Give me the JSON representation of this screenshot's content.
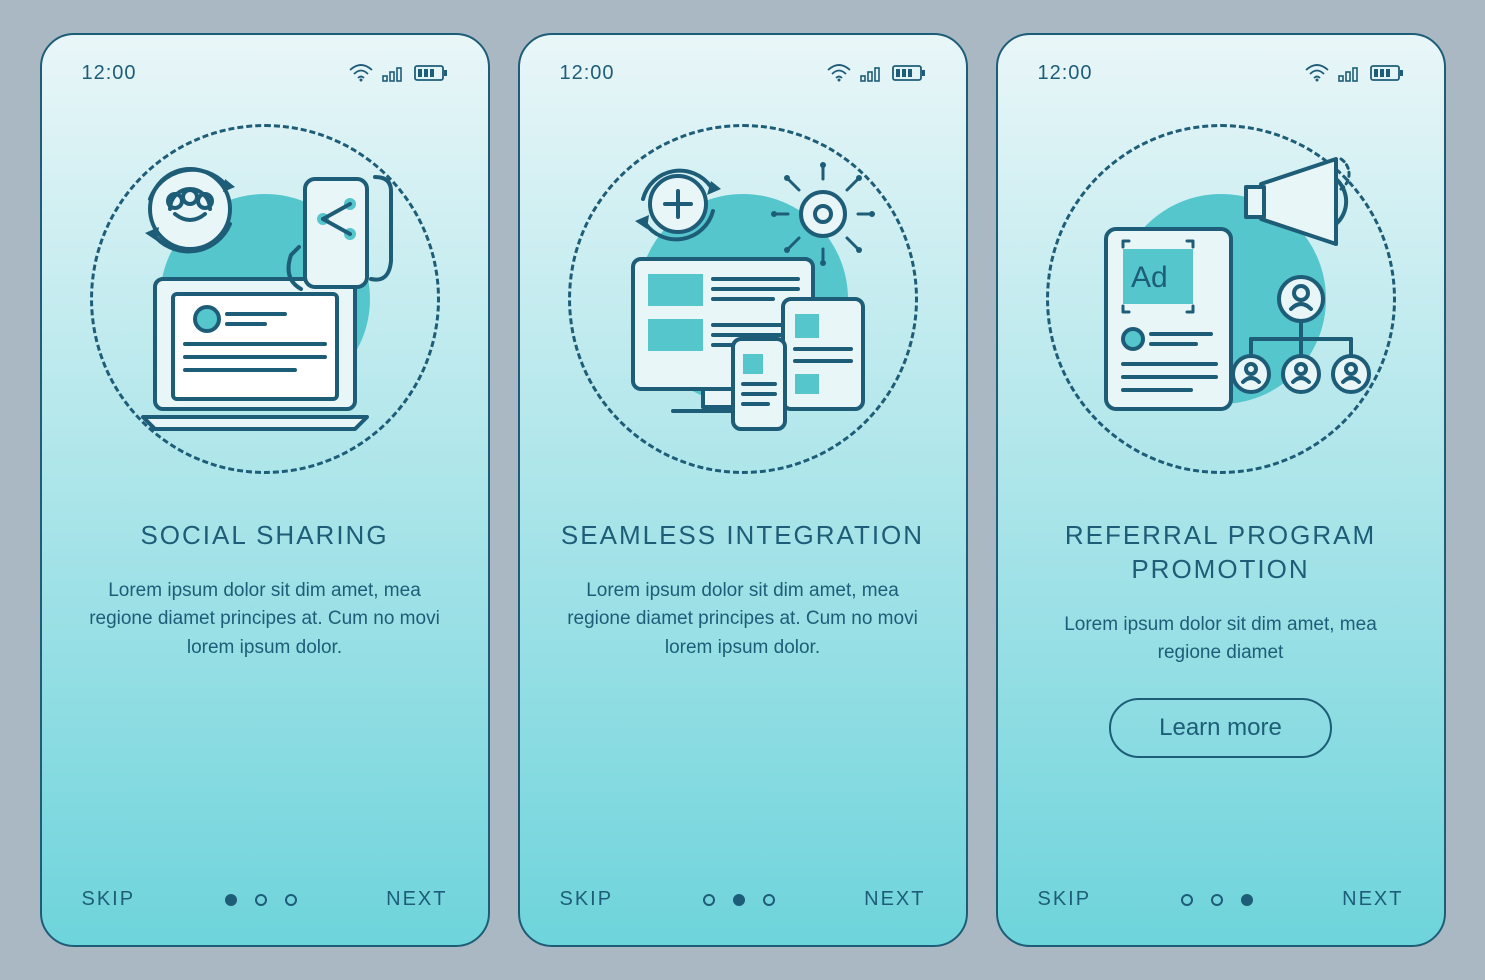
{
  "statusbar": {
    "time": "12:00"
  },
  "screens": [
    {
      "title": "Social sharing",
      "body": "Lorem ipsum dolor sit dim amet, mea regione diamet principes at. Cum no movi lorem ipsum dolor.",
      "skip": "SKIP",
      "next": "NEXT",
      "cta": null,
      "activeDot": 0
    },
    {
      "title": "Seamless integration",
      "body": "Lorem ipsum dolor sit dim amet, mea regione diamet principes at. Cum no movi lorem ipsum dolor.",
      "skip": "SKIP",
      "next": "NEXT",
      "cta": null,
      "activeDot": 1
    },
    {
      "title": "Referral program promotion",
      "body": "Lorem ipsum dolor sit dim amet, mea regione diamet",
      "skip": "SKIP",
      "next": "NEXT",
      "cta": "Learn more",
      "activeDot": 2
    }
  ],
  "colors": {
    "stroke": "#1e5d78",
    "accent": "#56c6cd",
    "bg": "#aab8c4"
  }
}
